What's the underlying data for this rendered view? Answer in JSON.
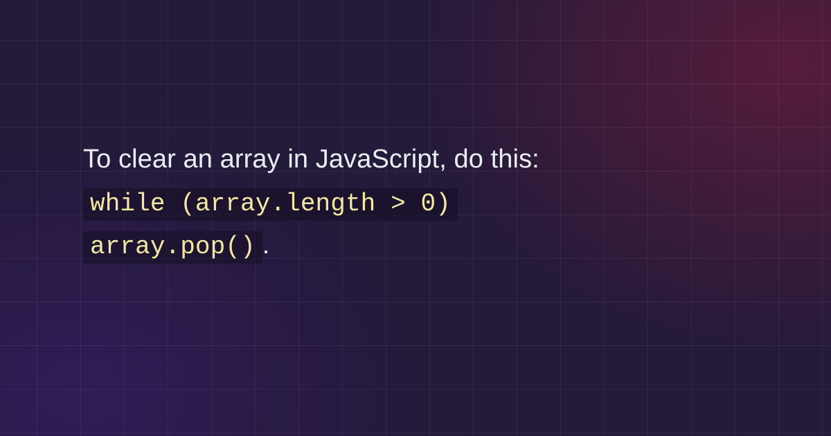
{
  "intro": "To clear an array in JavaScript, do this:",
  "code_line1": "while (array.length > 0)",
  "code_line2": "array.pop()",
  "period": "."
}
